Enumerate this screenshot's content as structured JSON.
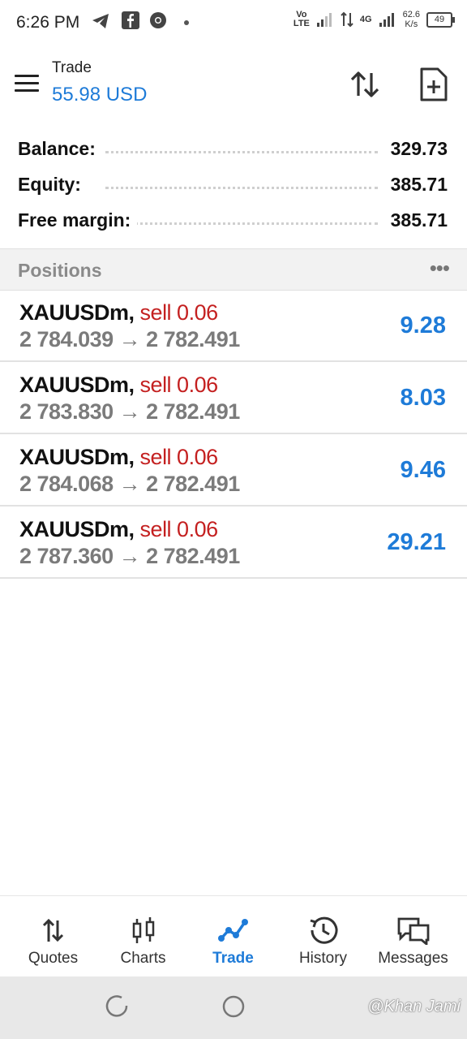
{
  "status_bar": {
    "time": "6:26 PM",
    "network_label_top": "Vo",
    "network_label_bottom": "LTE",
    "network_gen": "4G",
    "speed_value": "62.6",
    "speed_unit": "K/s",
    "battery": "49"
  },
  "header": {
    "title": "Trade",
    "subtitle": "55.98 USD",
    "accent_color": "#1e7bd8"
  },
  "account": [
    {
      "label": "Balance:",
      "value": "329.73"
    },
    {
      "label": "Equity:",
      "value": "385.71"
    },
    {
      "label": "Free margin:",
      "value": "385.71"
    }
  ],
  "positions_header": {
    "title": "Positions",
    "more": "•••"
  },
  "positions": [
    {
      "symbol": "XAUUSDm,",
      "side": "sell 0.06",
      "prices": "2 784.039 → 2 782.491",
      "profit": "9.28"
    },
    {
      "symbol": "XAUUSDm,",
      "side": "sell 0.06",
      "prices": "2 783.830 → 2 782.491",
      "profit": "8.03"
    },
    {
      "symbol": "XAUUSDm,",
      "side": "sell 0.06",
      "prices": "2 784.068 → 2 782.491",
      "profit": "9.46"
    },
    {
      "symbol": "XAUUSDm,",
      "side": "sell 0.06",
      "prices": "2 787.360 → 2 782.491",
      "profit": "29.21"
    }
  ],
  "bottom_nav": [
    {
      "label": "Quotes",
      "icon": "quotes-icon"
    },
    {
      "label": "Charts",
      "icon": "charts-icon"
    },
    {
      "label": "Trade",
      "icon": "trade-icon",
      "active": true
    },
    {
      "label": "History",
      "icon": "history-icon"
    },
    {
      "label": "Messages",
      "icon": "messages-icon"
    }
  ],
  "watermark": "@Khan Jami"
}
